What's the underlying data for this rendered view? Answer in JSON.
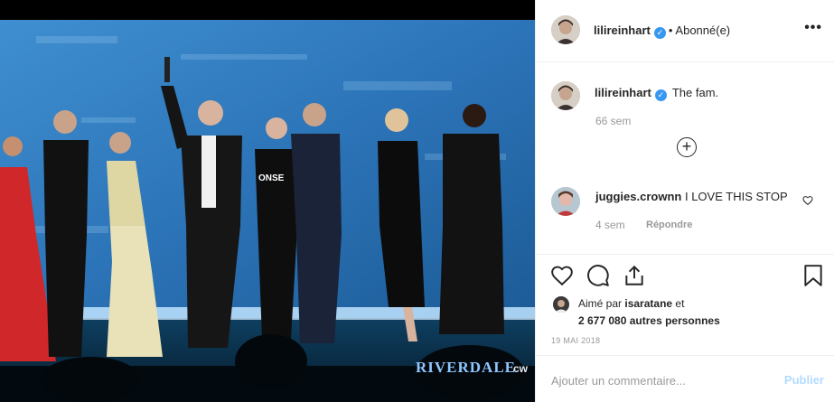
{
  "post": {
    "author": "lilireinhart",
    "follow_status": "Abonné(e)",
    "more_label": "•••"
  },
  "caption": {
    "author": "lilireinhart",
    "text": "The fam.",
    "time": "66 sem"
  },
  "comments": [
    {
      "author": "juggies.crownn",
      "text": "I LOVE THIS STOP",
      "time": "4 sem",
      "reply_label": "Répondre"
    }
  ],
  "likes": {
    "prefix": "Aimé par",
    "liker": "isaratane",
    "suffix": "et",
    "others": "2 677 080 autres personnes"
  },
  "date": "19 MAI 2018",
  "add_comment": {
    "placeholder": "Ajouter un commentaire...",
    "publish_label": "Publier"
  },
  "photo": {
    "watermark": "RIVERDALE",
    "network": "cw"
  },
  "colors": {
    "verified": "#3897f0",
    "publish_disabled": "#b3dbff",
    "muted": "#999999"
  },
  "icons": [
    "verified-badge-icon",
    "more-options-icon",
    "expand-plus-icon",
    "heart-icon",
    "comment-icon",
    "share-icon",
    "bookmark-icon"
  ]
}
